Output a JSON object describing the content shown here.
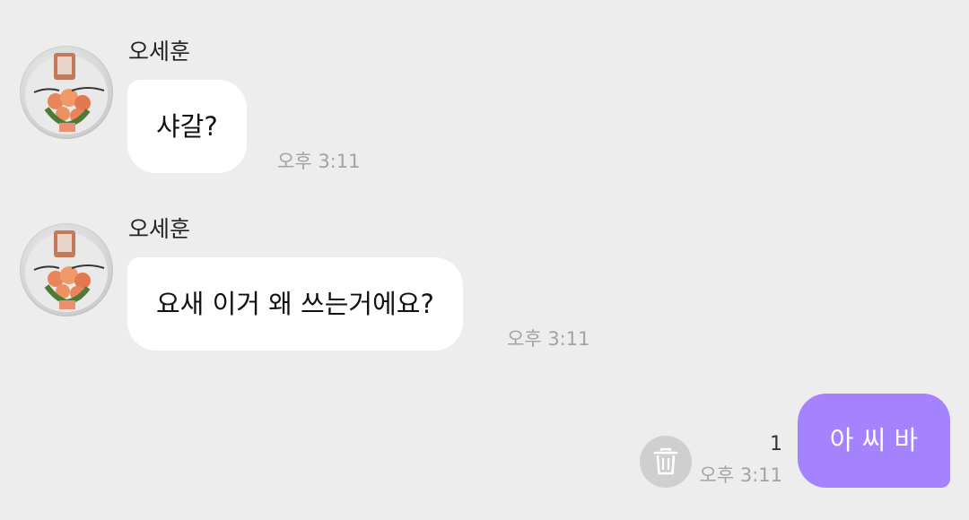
{
  "messages": [
    {
      "sender": "오세훈",
      "text": "샤갈?",
      "time": "오후 3:11",
      "avatar_icon": "profile-photo-flower-bouquet"
    },
    {
      "sender": "오세훈",
      "text": "요새 이거 왜 쓰는거에요?",
      "time": "오후 3:11",
      "avatar_icon": "profile-photo-flower-bouquet"
    },
    {
      "text": "아 씨 바",
      "time": "오후 3:11",
      "unread_count": "1",
      "action_icon": "trash-icon"
    }
  ],
  "colors": {
    "background": "#ededed",
    "incoming_bubble": "#ffffff",
    "outgoing_bubble": "#a583ff",
    "timestamp": "#a3a3a3",
    "trash_button": "#cfcfcf"
  }
}
